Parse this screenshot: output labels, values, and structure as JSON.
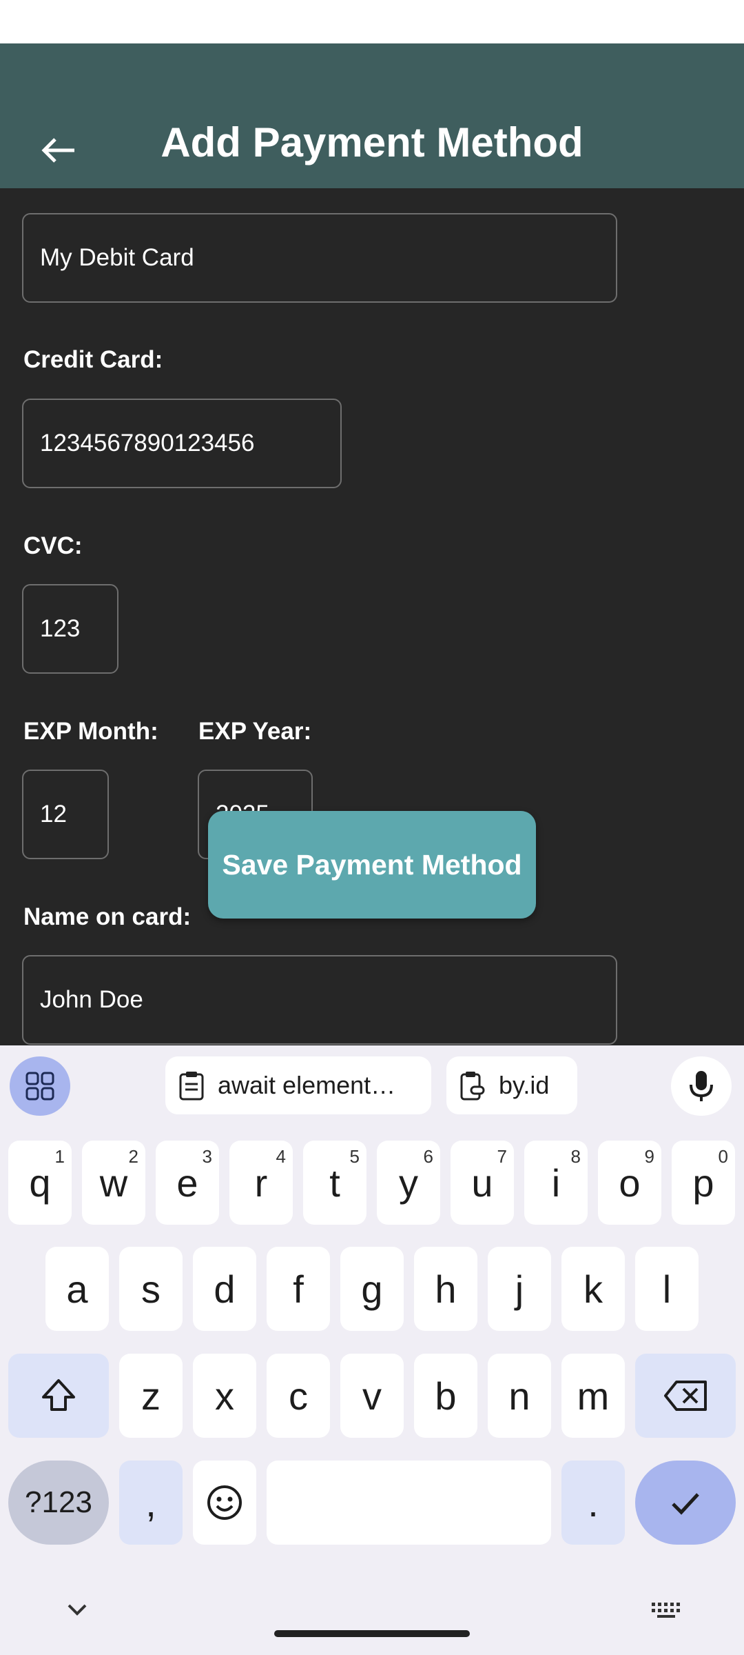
{
  "app": {
    "title": "Add Payment Method"
  },
  "form": {
    "card_nickname_value": "My Debit Card",
    "credit_card_label": "Credit Card:",
    "credit_card_value": "1234567890123456",
    "cvc_label": "CVC:",
    "cvc_value": "123",
    "exp_month_label": "EXP Month:",
    "exp_month_value": "12",
    "exp_year_label": "EXP Year:",
    "exp_year_value": "2025",
    "name_label": "Name on card:",
    "name_value": "John Doe",
    "save_button_label": "Save Payment Method"
  },
  "keyboard": {
    "suggestions": [
      "await element…",
      "by.id"
    ],
    "row1": [
      {
        "key": "q",
        "hint": "1"
      },
      {
        "key": "w",
        "hint": "2"
      },
      {
        "key": "e",
        "hint": "3"
      },
      {
        "key": "r",
        "hint": "4"
      },
      {
        "key": "t",
        "hint": "5"
      },
      {
        "key": "y",
        "hint": "6"
      },
      {
        "key": "u",
        "hint": "7"
      },
      {
        "key": "i",
        "hint": "8"
      },
      {
        "key": "o",
        "hint": "9"
      },
      {
        "key": "p",
        "hint": "0"
      }
    ],
    "row2": [
      "a",
      "s",
      "d",
      "f",
      "g",
      "h",
      "j",
      "k",
      "l"
    ],
    "row3": [
      "z",
      "x",
      "c",
      "v",
      "b",
      "n",
      "m"
    ],
    "symbols_label": "?123",
    "comma": ",",
    "period": "."
  },
  "colors": {
    "app_bar": "#3f5e5e",
    "content_bg": "#262626",
    "accent_button": "#5da8ae",
    "keyboard_bg": "#f0eef5",
    "keyboard_fn": "#dde3f8",
    "enter_key": "#a8b5ee"
  }
}
